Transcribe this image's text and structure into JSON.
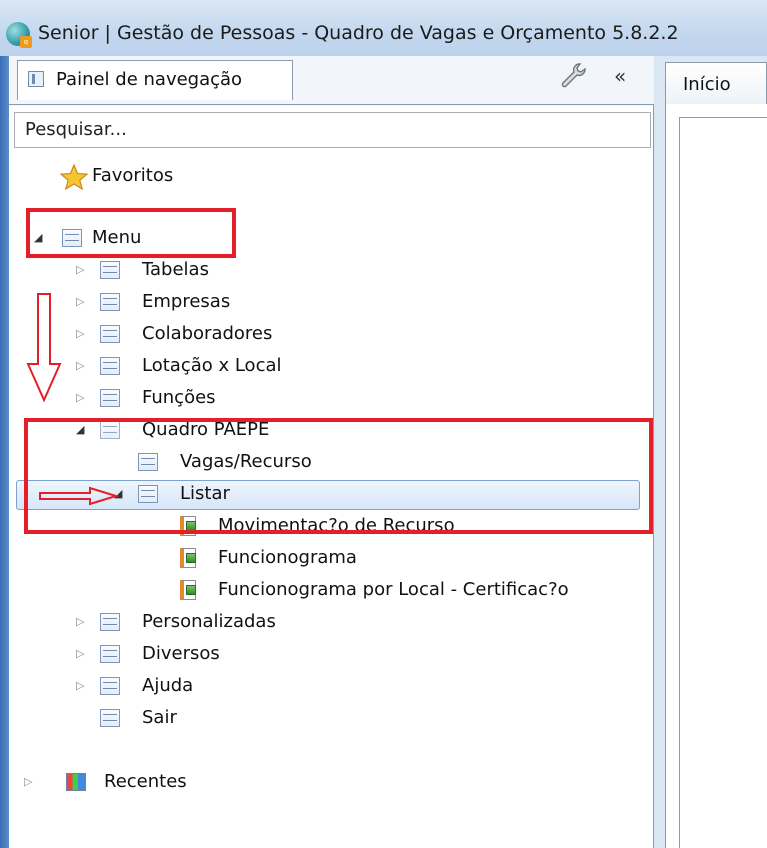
{
  "window": {
    "title": "Senior | Gestão de Pessoas - Quadro de Vagas e Orçamento 5.8.2.2",
    "icon": "senior-app-icon"
  },
  "nav_panel": {
    "tab_label": "Painel de navegação",
    "collapse_glyph": "«",
    "search_placeholder": "Pesquisar..."
  },
  "right_panel": {
    "tab_label": "Início"
  },
  "tree": {
    "favorites": "Favoritos",
    "menu": "Menu",
    "menu_items": [
      "Tabelas",
      "Empresas",
      "Colaboradores",
      "Lotação x Local",
      "Funções"
    ],
    "quadro": "Quadro PAEPE",
    "quadro_children": {
      "vagas": "Vagas/Recurso",
      "listar": "Listar",
      "listar_children": [
        "Movimentac?o de Recurso",
        "Funcionograma",
        "Funcionograma por Local - Certificac?o"
      ]
    },
    "menu_items_after": [
      "Personalizadas",
      "Diversos",
      "Ajuda",
      "Sair"
    ],
    "recent": "Recentes"
  },
  "annotation_colors": {
    "highlight": "#e3202a",
    "selection": "#d7e6f8"
  }
}
